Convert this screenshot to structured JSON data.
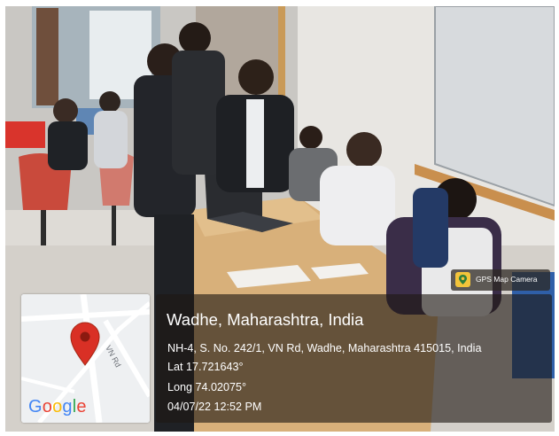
{
  "overlay": {
    "place_title": "Wadhe, Maharashtra, India",
    "address": "NH-4, S. No. 242/1, VN Rd, Wadhe, Maharashtra 415015, India",
    "latitude": "Lat 17.721643°",
    "longitude": "Long 74.02075°",
    "datetime": "04/07/22 12:52 PM"
  },
  "map": {
    "road_label": "VN Rd",
    "provider_logo": "Google",
    "pin_icon": "map-pin-icon",
    "pin_color": "#d93025"
  },
  "app_badge": {
    "label": "GPS Map Camera",
    "icon": "camera-app-icon",
    "icon_color": "#f4c43a"
  },
  "scene_description_colors": {
    "wall": "#e6e4e0",
    "desk": "#d9b27c",
    "whiteboard": "#dcdfe2",
    "floor": "#d8d4ce"
  }
}
